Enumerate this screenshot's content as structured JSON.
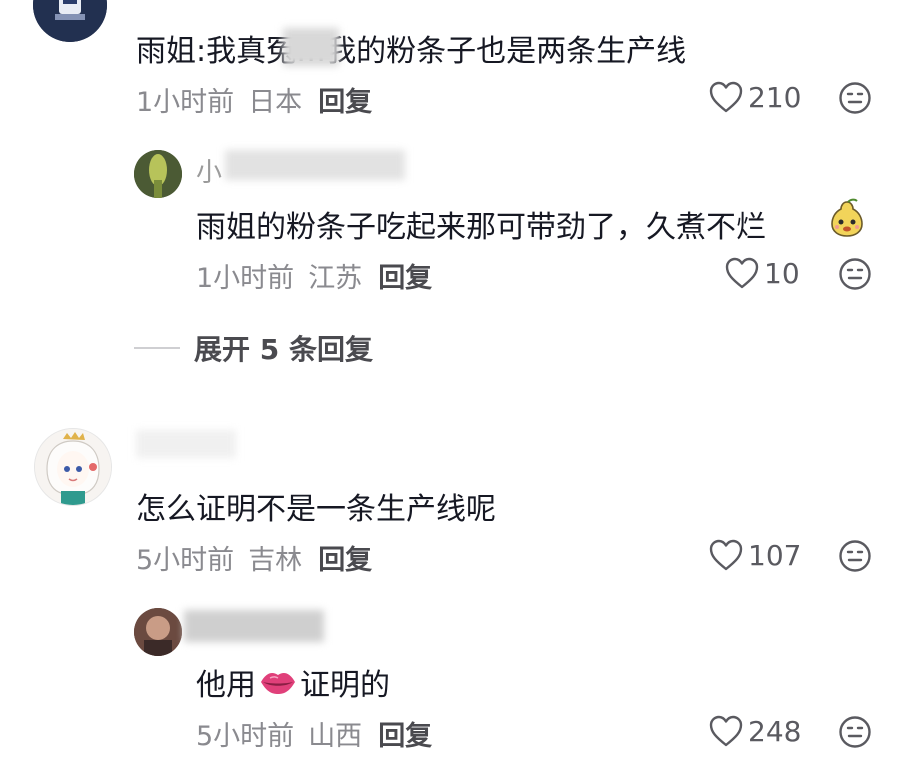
{
  "comments": [
    {
      "username": "",
      "content": "雨姐:我真冤…我的粉条子也是两条生产线",
      "time": "1小时前",
      "location": "日本",
      "reply": "回复",
      "likes": "210",
      "replies": [
        {
          "username": "小",
          "content": "雨姐的粉条子吃起来那可带劲了，久煮不烂",
          "time": "1小时前",
          "location": "江苏",
          "reply": "回复",
          "likes": "10"
        }
      ],
      "expand_label": "展开 5 条回复"
    },
    {
      "username": "",
      "content": "怎么证明不是一条生产线呢",
      "time": "5小时前",
      "location": "吉林",
      "reply": "回复",
      "likes": "107",
      "replies": [
        {
          "username": "",
          "content_before": "他用",
          "content_after": "证明的",
          "time": "5小时前",
          "location": "山西",
          "reply": "回复",
          "likes": "248"
        }
      ]
    }
  ],
  "icons": {
    "like": "heart-outline-icon",
    "dislike": "neutral-face-icon",
    "emoji_pear": "pear-face-emoji",
    "emoji_lips": "lips-emoji"
  },
  "colors": {
    "text": "#161823",
    "meta": "#8a8a8f",
    "reply": "#4a4a4f",
    "lips": "#e0407a"
  }
}
